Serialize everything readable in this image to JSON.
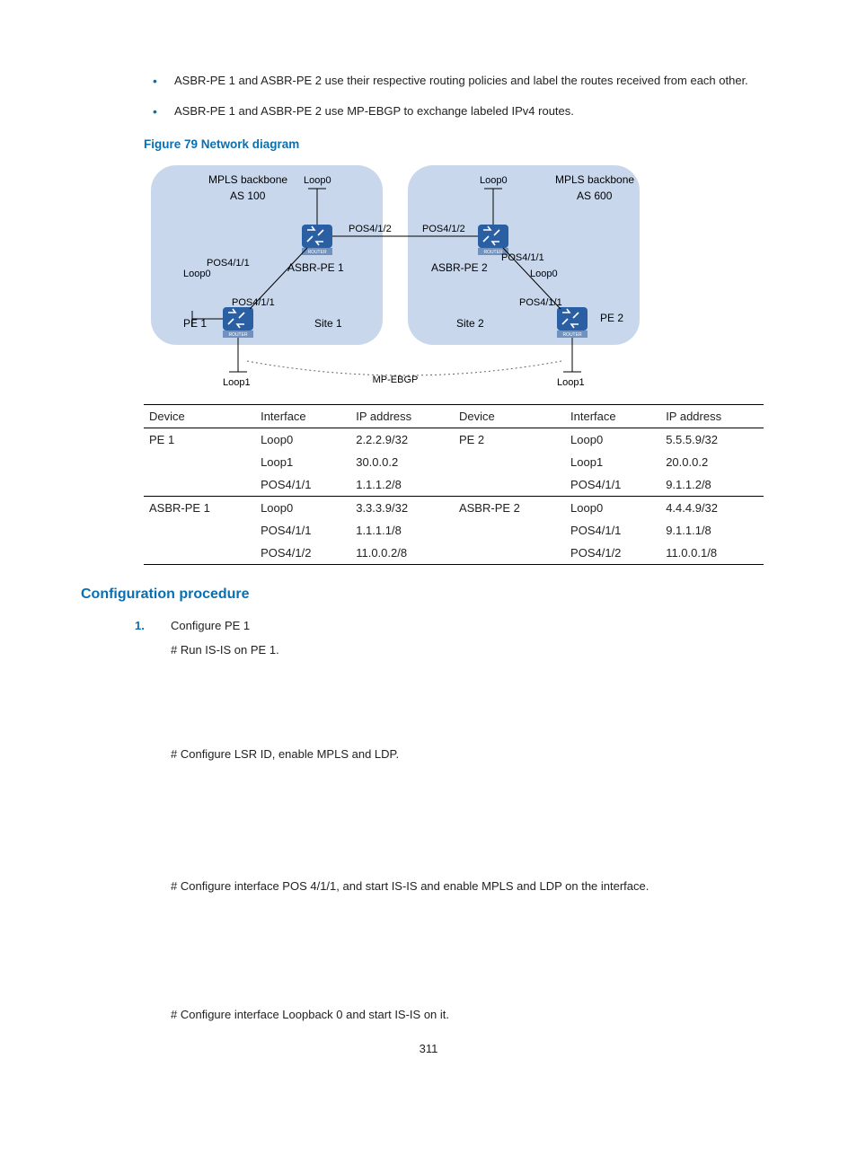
{
  "bullets": [
    "ASBR-PE 1 and ASBR-PE 2 use their respective routing policies and label the routes received from each other.",
    "ASBR-PE 1 and ASBR-PE 2 use MP-EBGP to exchange labeled IPv4 routes."
  ],
  "figure_title": "Figure 79 Network diagram",
  "diagram": {
    "backbone_left": "MPLS backbone",
    "as_left": "AS 100",
    "backbone_right": "MPLS backbone",
    "as_right": "AS 600",
    "loop0": "Loop0",
    "loop1": "Loop1",
    "pos411": "POS4/1/1",
    "pos412": "POS4/1/2",
    "asbrpe1": "ASBR-PE 1",
    "asbrpe2": "ASBR-PE 2",
    "pe1": "PE 1",
    "pe2": "PE 2",
    "site1": "Site 1",
    "site2": "Site 2",
    "mpebgp": "MP-EBGP",
    "router": "ROUTER"
  },
  "table": {
    "headers": [
      "Device",
      "Interface",
      "IP address",
      "Device",
      "Interface",
      "IP address"
    ],
    "rows": [
      {
        "group_start": true,
        "cells": [
          "PE 1",
          "Loop0",
          "2.2.2.9/32",
          "PE 2",
          "Loop0",
          "5.5.5.9/32"
        ]
      },
      {
        "group_start": false,
        "cells": [
          "",
          "Loop1",
          "30.0.0.2",
          "",
          "Loop1",
          "20.0.0.2"
        ]
      },
      {
        "group_start": false,
        "cells": [
          "",
          "POS4/1/1",
          "1.1.1.2/8",
          "",
          "POS4/1/1",
          "9.1.1.2/8"
        ]
      },
      {
        "group_start": true,
        "cells": [
          "ASBR-PE 1",
          "Loop0",
          "3.3.3.9/32",
          "ASBR-PE 2",
          "Loop0",
          "4.4.4.9/32"
        ]
      },
      {
        "group_start": false,
        "cells": [
          "",
          "POS4/1/1",
          "1.1.1.1/8",
          "",
          "POS4/1/1",
          "9.1.1.1/8"
        ]
      },
      {
        "group_start": false,
        "last": true,
        "cells": [
          "",
          "POS4/1/2",
          "11.0.0.2/8",
          "",
          "POS4/1/2",
          "11.0.0.1/8"
        ]
      }
    ]
  },
  "section_heading": "Configuration procedure",
  "step1": {
    "num": "1.",
    "title": "Configure PE 1",
    "lines": [
      "# Run IS-IS on PE 1.",
      "# Configure LSR ID, enable MPLS and LDP.",
      "# Configure interface POS 4/1/1, and start IS-IS and enable MPLS and LDP on the interface.",
      "# Configure interface Loopback 0 and start IS-IS on it."
    ]
  },
  "page_number": "311"
}
